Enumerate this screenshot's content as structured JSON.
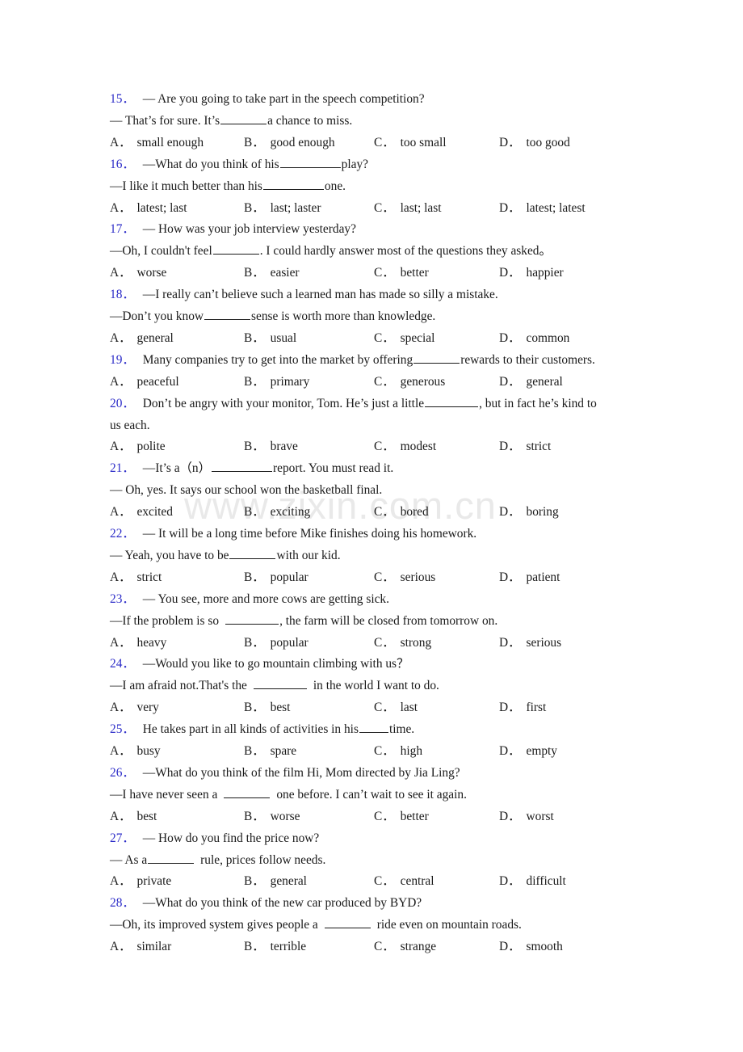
{
  "watermark": {
    "text": "www.zixin.com.cn"
  },
  "colors": {
    "question_number": "#2c2cc8",
    "body_text": "#1a1a1a",
    "watermark": "#e9e9e9"
  },
  "option_letters": {
    "a": "A．",
    "b": "B．",
    "c": "C．",
    "d": "D．"
  },
  "questions": [
    {
      "number": "15．",
      "lines": [
        "— Are you going to take part in the speech competition?",
        "— That’s for sure. It’s ",
        " a chance to miss."
      ],
      "stem_1": "— Are you going to take part in the speech competition?",
      "stem_2a": "— That’s for sure. It’s",
      "stem_2b": "a chance to miss.",
      "options": [
        "small enough",
        "good enough",
        "too small",
        "too good"
      ]
    },
    {
      "number": "16．",
      "stem_1a": "—What do you think of his",
      "stem_1b": "play?",
      "stem_2a": "—I like it much better than his",
      "stem_2b": "one.",
      "options": [
        "latest; last",
        "last; laster",
        "last; last",
        "latest; latest"
      ]
    },
    {
      "number": "17．",
      "stem_1": "— How was your job interview yesterday?",
      "stem_2a": "—Oh, I couldn't feel",
      "stem_2b": ". I could hardly answer most of the questions they asked。",
      "options": [
        "worse",
        "easier",
        "better",
        "happier"
      ]
    },
    {
      "number": "18．",
      "stem_1": "—I really can’t believe such a learned man has made so silly a mistake.",
      "stem_2a": "—Don’t you know",
      "stem_2b": "sense is worth more than knowledge.",
      "options": [
        "general",
        "usual",
        "special",
        "common"
      ]
    },
    {
      "number": "19．",
      "stem_1a": "Many companies try to get into the market by offering",
      "stem_1b": "rewards to their customers.",
      "options": [
        "peaceful",
        "primary",
        "generous",
        "general"
      ]
    },
    {
      "number": "20．",
      "stem_1a": "Don’t be angry with your monitor, Tom. He’s just a little",
      "stem_1b": ", but in fact he’s kind to",
      "stem_2": "us each.",
      "options": [
        "polite",
        "brave",
        "modest",
        "strict"
      ]
    },
    {
      "number": "21．",
      "stem_1a": "—It’s a（n）",
      "stem_1b": "report. You must read it.",
      "stem_2": "— Oh, yes. It says our school won the basketball final.",
      "options": [
        "excited",
        "exciting",
        "bored",
        "boring"
      ]
    },
    {
      "number": "22．",
      "stem_1": "— It will be a long time before Mike finishes doing his homework.",
      "stem_2a": "— Yeah, you have to be",
      "stem_2b": "with our kid.",
      "options": [
        "strict",
        "popular",
        "serious",
        "patient"
      ]
    },
    {
      "number": "23．",
      "stem_1": "— You see, more and more cows are getting sick.",
      "stem_2a": "—If the problem is so",
      "stem_2b": ", the farm will be closed from tomorrow on.",
      "options": [
        "heavy",
        "popular",
        "strong",
        "serious"
      ]
    },
    {
      "number": "24．",
      "stem_1": "—Would you like to go mountain climbing with us？",
      "stem_2a": "—I am afraid not.That's the",
      "stem_2b": "in the world I want to do.",
      "options": [
        "very",
        "best",
        "last",
        "first"
      ]
    },
    {
      "number": "25．",
      "stem_1a": "He takes part in all kinds of activities in his",
      "stem_1b": "time.",
      "options": [
        "busy",
        "spare",
        "high",
        "empty"
      ]
    },
    {
      "number": "26．",
      "stem_1": "—What do you think of the film Hi, Mom directed by Jia Ling?",
      "stem_2a": "—I have never seen a",
      "stem_2b": "one before. I can’t wait to see it again.",
      "options": [
        "best",
        "worse",
        "better",
        "worst"
      ]
    },
    {
      "number": "27．",
      "stem_1": "— How do you find the price now?",
      "stem_2a": "— As a",
      "stem_2b": "rule, prices follow needs.",
      "options": [
        "private",
        "general",
        "central",
        "difficult"
      ]
    },
    {
      "number": "28．",
      "stem_1": "—What do you think of the new car produced by BYD?",
      "stem_2a": "—Oh, its improved system gives people a",
      "stem_2b": "ride even on mountain roads.",
      "options": [
        "similar",
        "terrible",
        "strange",
        "smooth"
      ]
    }
  ]
}
